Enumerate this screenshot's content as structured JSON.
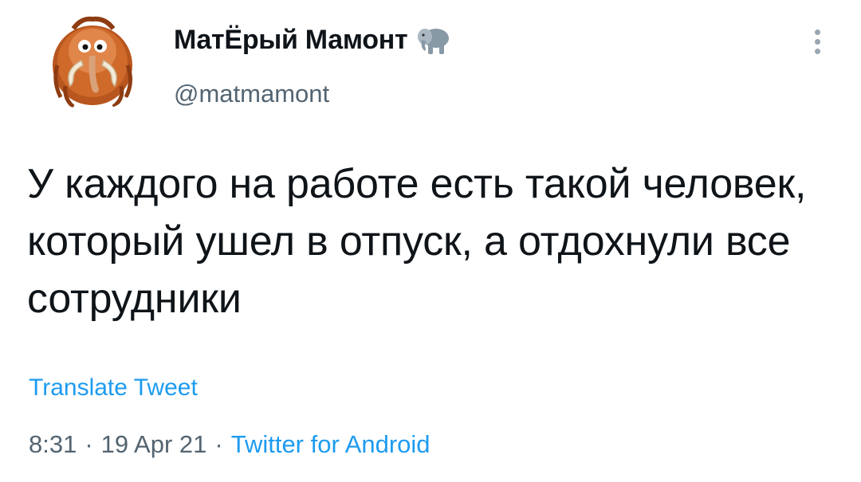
{
  "author": {
    "display_name": "МатЁрый Мамонт",
    "handle": "@matmamont",
    "badge_icon": "elephant-icon",
    "avatar_icon": "mammoth-avatar"
  },
  "tweet": {
    "text": "У каждого на работе есть такой человек, который ушел в отпуск, а отдохнули все сотрудники",
    "translate_label": "Translate Tweet",
    "time": "8:31",
    "date": "19 Apr 21",
    "separator": "·",
    "source": "Twitter for Android"
  },
  "colors": {
    "link": "#1d9bf0",
    "secondary_text": "#536471",
    "primary_text": "#0f1419",
    "background": "#ffffff"
  },
  "icons": {
    "more": "more-vertical-icon"
  }
}
